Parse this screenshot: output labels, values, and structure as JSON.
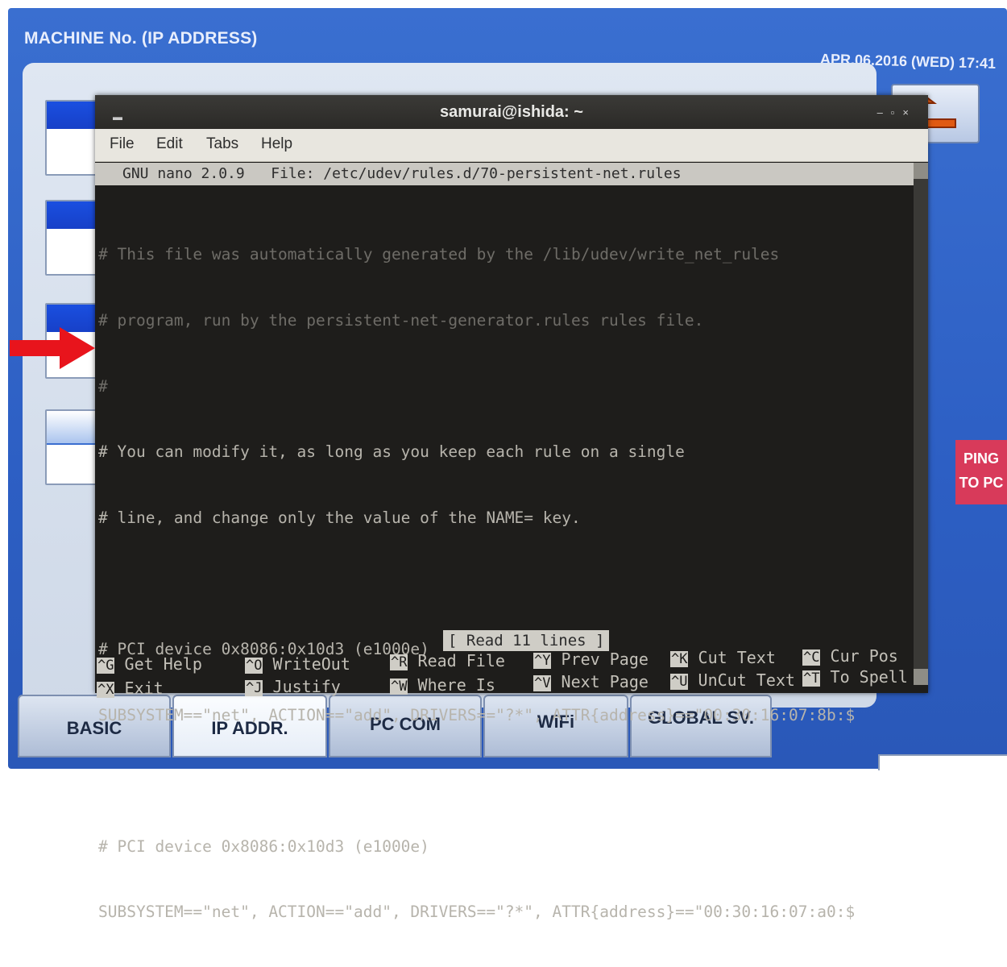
{
  "screen": {
    "title": "MACHINE No. (IP ADDRESS)",
    "datetime": "APR.06.2016 (WED)  17:41",
    "ping_button": "PING\nTO PC",
    "ping_line1": "PING",
    "ping_line2": "TO PC",
    "tabs": [
      "BASIC",
      "IP ADDR.",
      "PC COM",
      "WiFi",
      "GLOBAL SV."
    ],
    "active_tab": "IP ADDR."
  },
  "terminal": {
    "title": "samurai@ishida: ~",
    "menu": [
      "File",
      "Edit",
      "Tabs",
      "Help"
    ],
    "nano_header": "GNU nano 2.0.9   File: /etc/udev/rules.d/70-persistent-net.rules",
    "lines": [
      "# This file was automatically generated by the /lib/udev/write_net_rules",
      "# program, run by the persistent-net-generator.rules rules file.",
      "#",
      "# You can modify it, as long as you keep each rule on a single",
      "# line, and change only the value of the NAME= key.",
      "",
      "# PCI device 0x8086:0x10d3 (e1000e)",
      "SUBSYSTEM==\"net\", ACTION==\"add\", DRIVERS==\"?*\", ATTR{address}==\"00:30:16:07:8b:$",
      "",
      "# PCI device 0x8086:0x10d3 (e1000e)",
      "SUBSYSTEM==\"net\", ACTION==\"add\", DRIVERS==\"?*\", ATTR{address}==\"00:30:16:07:a0:$"
    ],
    "status_message": "[ Read 11 lines ]",
    "shortcuts_row1": [
      {
        "key": "^G",
        "label": "Get Help"
      },
      {
        "key": "^O",
        "label": "WriteOut"
      },
      {
        "key": "^R",
        "label": "Read File"
      },
      {
        "key": "^Y",
        "label": "Prev Page"
      },
      {
        "key": "^K",
        "label": "Cut Text"
      },
      {
        "key": "^C",
        "label": "Cur Pos"
      }
    ],
    "shortcuts_row2": [
      {
        "key": "^X",
        "label": "Exit"
      },
      {
        "key": "^J",
        "label": "Justify"
      },
      {
        "key": "^W",
        "label": "Where Is"
      },
      {
        "key": "^V",
        "label": "Next Page"
      },
      {
        "key": "^U",
        "label": "UnCut Text"
      },
      {
        "key": "^T",
        "label": "To Spell"
      }
    ]
  },
  "annotation": {
    "arrow_color": "#e8141c"
  },
  "colors": {
    "screen_blue": "#2d5fc4",
    "terminal_bg": "#1e1d1b",
    "ping_red": "#d83a5a"
  }
}
